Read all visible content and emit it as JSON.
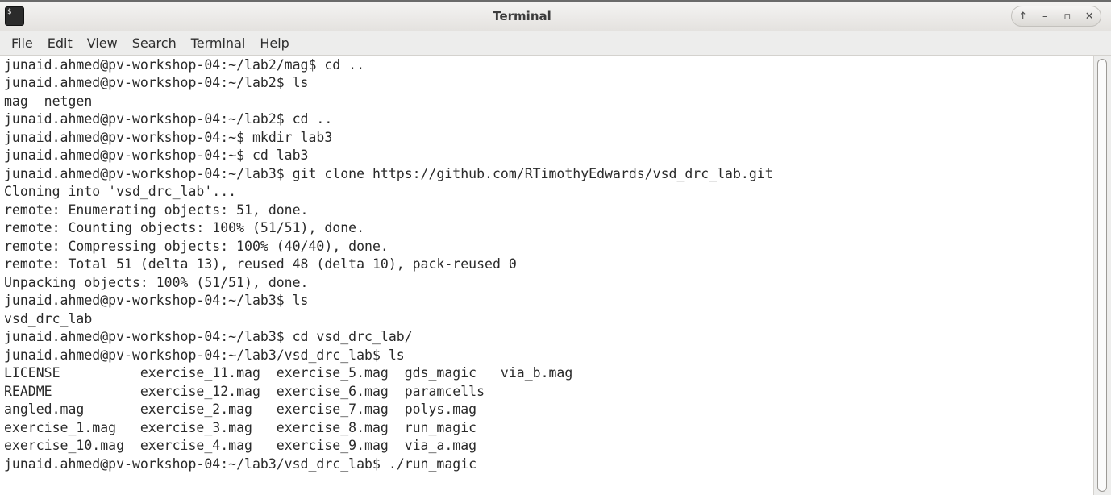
{
  "window": {
    "title": "Terminal",
    "icon": "terminal-app-icon",
    "icon_glyph": "$_",
    "controls": [
      {
        "name": "menu-button",
        "glyph": "↑"
      },
      {
        "name": "minimize-button",
        "glyph": "–"
      },
      {
        "name": "maximize-button",
        "glyph": "▫"
      },
      {
        "name": "close-button",
        "glyph": "✕"
      }
    ]
  },
  "menubar": {
    "items": [
      "File",
      "Edit",
      "View",
      "Search",
      "Terminal",
      "Help"
    ]
  },
  "terminal": {
    "lines": [
      "junaid.ahmed@pv-workshop-04:~/lab2/mag$ cd ..",
      "junaid.ahmed@pv-workshop-04:~/lab2$ ls",
      "mag  netgen",
      "junaid.ahmed@pv-workshop-04:~/lab2$ cd ..",
      "junaid.ahmed@pv-workshop-04:~$ mkdir lab3",
      "junaid.ahmed@pv-workshop-04:~$ cd lab3",
      "junaid.ahmed@pv-workshop-04:~/lab3$ git clone https://github.com/RTimothyEdwards/vsd_drc_lab.git",
      "Cloning into 'vsd_drc_lab'...",
      "remote: Enumerating objects: 51, done.",
      "remote: Counting objects: 100% (51/51), done.",
      "remote: Compressing objects: 100% (40/40), done.",
      "remote: Total 51 (delta 13), reused 48 (delta 10), pack-reused 0",
      "Unpacking objects: 100% (51/51), done.",
      "junaid.ahmed@pv-workshop-04:~/lab3$ ls",
      "vsd_drc_lab",
      "junaid.ahmed@pv-workshop-04:~/lab3$ cd vsd_drc_lab/",
      "junaid.ahmed@pv-workshop-04:~/lab3/vsd_drc_lab$ ls",
      "LICENSE          exercise_11.mag  exercise_5.mag  gds_magic   via_b.mag",
      "README           exercise_12.mag  exercise_6.mag  paramcells",
      "angled.mag       exercise_2.mag   exercise_7.mag  polys.mag",
      "exercise_1.mag   exercise_3.mag   exercise_8.mag  run_magic",
      "exercise_10.mag  exercise_4.mag   exercise_9.mag  via_a.mag",
      "junaid.ahmed@pv-workshop-04:~/lab3/vsd_drc_lab$ ./run_magic"
    ]
  },
  "colors": {
    "terminal_background": "#ffffff",
    "terminal_foreground": "#2a2a2a",
    "chrome": "#ededec"
  }
}
